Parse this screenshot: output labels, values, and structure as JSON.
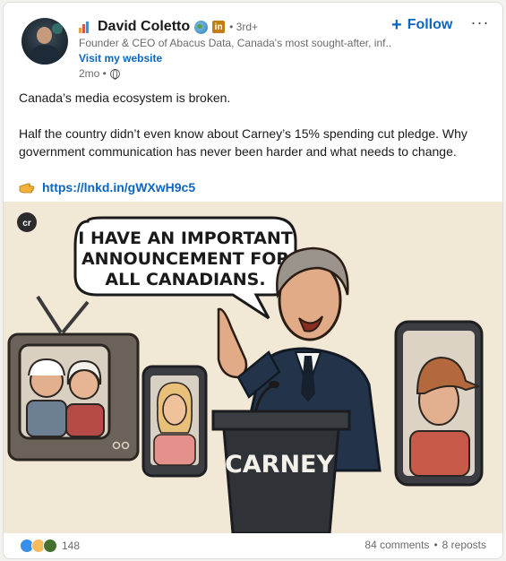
{
  "post": {
    "author": {
      "name": "David Coletto",
      "degree": "• 3rd+",
      "headline": "Founder & CEO of Abacus Data, Canada's most sought-after, inf...",
      "visit_label": "Visit my website",
      "time": "2mo •"
    },
    "follow_label": "Follow",
    "more_label": "···",
    "body": {
      "line1": "Canada’s media ecosystem is broken.",
      "line2": "Half the country didn’t even know about Carney’s 15% spending cut pledge. Why government communication has never been harder and what needs to change.",
      "link": "https://lnkd.in/gWXwH9c5"
    },
    "image": {
      "logo": "cr",
      "speech_line1": "I HAVE AN IMPORTANT",
      "speech_line2": "ANNOUNCEMENT FOR",
      "speech_line3": "ALL CANADIANS.",
      "podium_label": "CARNEY"
    },
    "social": {
      "reaction_count": "148",
      "comments": "84 comments",
      "separator": "•",
      "reposts": "8 reposts"
    }
  },
  "colors": {
    "link_blue": "#0a66c2",
    "badge_gold": "#c37d16",
    "muted_text": "rgba(0,0,0,0.6)"
  },
  "icons": [
    "bar-chart-icon",
    "globe-icon",
    "linkedin-badge-icon",
    "plus-icon",
    "more-icon",
    "globe-visibility-icon",
    "pointing-hand-icon",
    "like-reaction-icon",
    "celebrate-reaction-icon",
    "insightful-reaction-icon"
  ]
}
